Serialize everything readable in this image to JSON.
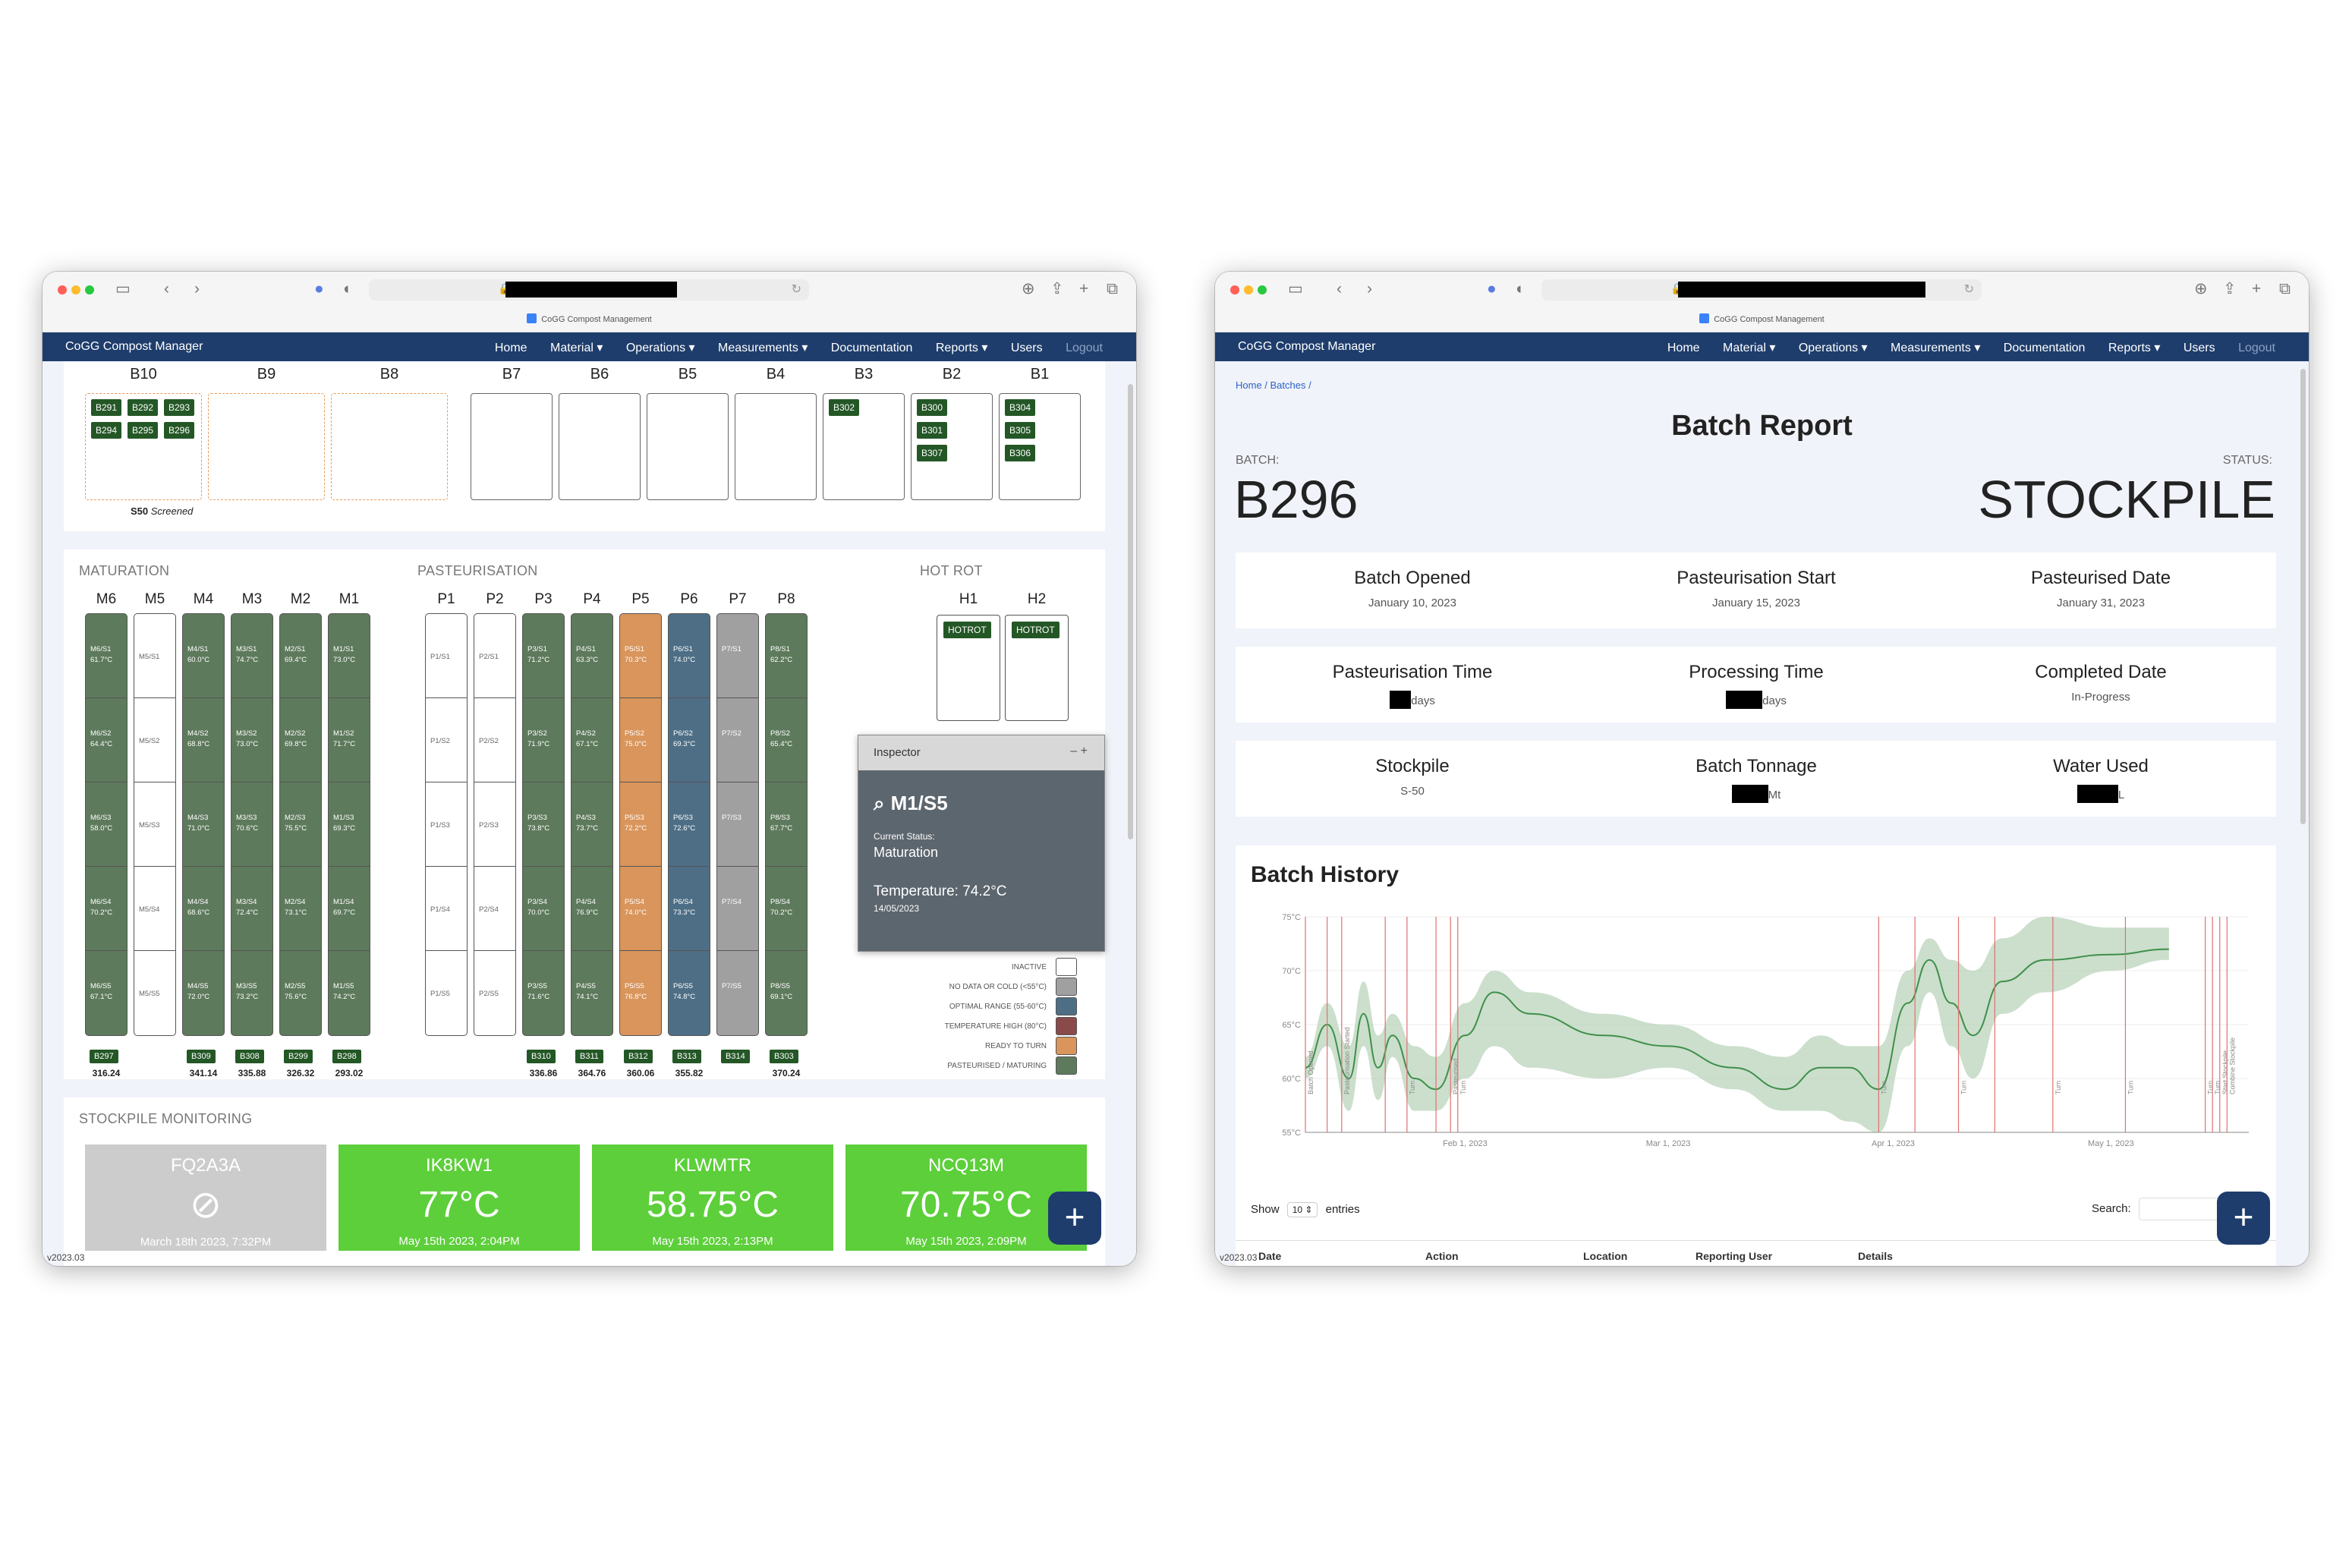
{
  "browser": {
    "tab_title": "CoGG Compost Management"
  },
  "nav": {
    "brand": "CoGG Compost Manager",
    "home": "Home",
    "material": "Material ▾",
    "operations": "Operations ▾",
    "measurements": "Measurements ▾",
    "documentation": "Documentation",
    "reports": "Reports ▾",
    "users": "Users",
    "logout": "Logout"
  },
  "bays": {
    "headers": [
      "B10",
      "B9",
      "B8",
      "B7",
      "B6",
      "B5",
      "B4",
      "B3",
      "B2",
      "B1"
    ],
    "b10_tags": [
      "B291",
      "B292",
      "B293",
      "B294",
      "B295",
      "B296"
    ],
    "b3_tags": [
      "B302"
    ],
    "b2_tags": [
      "B300",
      "B301",
      "B307"
    ],
    "b1_tags": [
      "B304",
      "B305",
      "B306"
    ],
    "b10_footer_code": "S50",
    "b10_footer_status": "Screened"
  },
  "sections": {
    "maturation": "MATURATION",
    "pasteurisation": "PASTEURISATION",
    "hot_rot": "HOT ROT",
    "stockpile": "STOCKPILE MONITORING"
  },
  "columns": [
    {
      "name": "M6",
      "color": "#5e7a5c",
      "cells": [
        "M6/S1 61.7°C",
        "M6/S2 64.4°C",
        "M6/S3 58.0°C",
        "M6/S4 70.2°C",
        "M6/S5 67.1°C"
      ],
      "batch": "B297",
      "value": "316.24"
    },
    {
      "name": "M5",
      "color": "#ffffff",
      "cells": [
        "M5/S1",
        "M5/S2",
        "M5/S3",
        "M5/S4",
        "M5/S5"
      ],
      "batch": "",
      "value": ""
    },
    {
      "name": "M4",
      "color": "#5e7a5c",
      "cells": [
        "M4/S1 60.0°C",
        "M4/S2 68.8°C",
        "M4/S3 71.0°C",
        "M4/S4 68.6°C",
        "M4/S5 72.0°C"
      ],
      "batch": "B309",
      "value": "341.14"
    },
    {
      "name": "M3",
      "color": "#5e7a5c",
      "cells": [
        "M3/S1 74.7°C",
        "M3/S2 73.0°C",
        "M3/S3 70.6°C",
        "M3/S4 72.4°C",
        "M3/S5 73.2°C"
      ],
      "batch": "B308",
      "value": "335.88"
    },
    {
      "name": "M2",
      "color": "#5e7a5c",
      "cells": [
        "M2/S1 69.4°C",
        "M2/S2 69.8°C",
        "M2/S3 75.5°C",
        "M2/S4 73.1°C",
        "M2/S5 75.6°C"
      ],
      "batch": "B299",
      "value": "326.32"
    },
    {
      "name": "M1",
      "color": "#5e7a5c",
      "cells": [
        "M1/S1 73.0°C",
        "M1/S2 71.7°C",
        "M1/S3 69.3°C",
        "M1/S4 69.7°C",
        "M1/S5 74.2°C"
      ],
      "batch": "B298",
      "value": "293.02"
    },
    {
      "name": "P1",
      "color": "#ffffff",
      "cells": [
        "P1/S1",
        "P1/S2",
        "P1/S3",
        "P1/S4",
        "P1/S5"
      ],
      "batch": "",
      "value": ""
    },
    {
      "name": "P2",
      "color": "#ffffff",
      "cells": [
        "P2/S1",
        "P2/S2",
        "P2/S3",
        "P2/S4",
        "P2/S5"
      ],
      "batch": "",
      "value": ""
    },
    {
      "name": "P3",
      "color": "#5e7a5c",
      "cells": [
        "P3/S1 71.2°C",
        "P3/S2 71.9°C",
        "P3/S3 73.8°C",
        "P3/S4 70.0°C",
        "P3/S5 71.6°C"
      ],
      "batch": "B310",
      "value": "336.86"
    },
    {
      "name": "P4",
      "color": "#5e7a5c",
      "cells": [
        "P4/S1 63.3°C",
        "P4/S2 67.1°C",
        "P4/S3 73.7°C",
        "P4/S4 76.9°C",
        "P4/S5 74.1°C"
      ],
      "batch": "B311",
      "value": "364.76"
    },
    {
      "name": "P5",
      "color": "#d9955b",
      "cells": [
        "P5/S1 70.3°C",
        "P5/S2 75.0°C",
        "P5/S3 72.2°C",
        "P5/S4 74.0°C",
        "P5/S5 76.8°C"
      ],
      "batch": "B312",
      "value": "360.06"
    },
    {
      "name": "P6",
      "color": "#4d6e85",
      "cells": [
        "P6/S1 74.0°C",
        "P6/S2 69.3°C",
        "P6/S3 72.6°C",
        "P6/S4 73.3°C",
        "P6/S5 74.8°C"
      ],
      "batch": "B313",
      "value": "355.82"
    },
    {
      "name": "P7",
      "color": "#a0a0a0",
      "cells": [
        "P7/S1",
        "P7/S2",
        "P7/S3",
        "P7/S4",
        "P7/S5"
      ],
      "batch": "B314",
      "value": ""
    },
    {
      "name": "P8",
      "color": "#5e7a5c",
      "cells": [
        "P8/S1 62.2°C",
        "P8/S2 65.4°C",
        "P8/S3 67.7°C",
        "P8/S4 70.2°C",
        "P8/S5 69.1°C"
      ],
      "batch": "B303",
      "value": "370.24"
    }
  ],
  "hotrot": {
    "h1": "H1",
    "h2": "H2",
    "tag": "HOTROT"
  },
  "legend": [
    {
      "label": "INACTIVE",
      "color": "#ffffff"
    },
    {
      "label": "NO DATA OR COLD (<55°C)",
      "color": "#a0a0a0"
    },
    {
      "label": "OPTIMAL RANGE (55-60°C)",
      "color": "#4d6e85"
    },
    {
      "label": "TEMPERATURE HIGH (80°C)",
      "color": "#8a4a4a"
    },
    {
      "label": "READY TO TURN",
      "color": "#d9955b"
    },
    {
      "label": "PASTEURISED / MATURING",
      "color": "#5e7a5c"
    }
  ],
  "inspector": {
    "title": "Inspector",
    "minimize": "–",
    "add": "+",
    "location": "M1/S5",
    "status_label": "Current Status:",
    "status": "Maturation",
    "temp": "Temperature: 74.2°C",
    "date": "14/05/2023"
  },
  "stockpile_cards": [
    {
      "name": "FQ2A3A",
      "temp": "",
      "date": "March 18th 2023, 7:32PM",
      "color": "#cccccc"
    },
    {
      "name": "IK8KW1",
      "temp": "77°C",
      "date": "May 15th 2023, 2:04PM",
      "color": "#5ccf3a"
    },
    {
      "name": "KLWMTR",
      "temp": "58.75°C",
      "date": "May 15th 2023, 2:13PM",
      "color": "#5ccf3a"
    },
    {
      "name": "NCQ13M",
      "temp": "70.75°C",
      "date": "May 15th 2023, 2:09PM",
      "color": "#5ccf3a"
    }
  ],
  "version": "v2023.03",
  "fab": "+",
  "report": {
    "breadcrumb": "Home / Batches /",
    "title": "Batch Report",
    "batch_label": "BATCH:",
    "batch": "B296",
    "status_label": "STATUS:",
    "status": "STOCKPILE",
    "row1": [
      {
        "h": "Batch Opened",
        "v": "January 10, 2023"
      },
      {
        "h": "Pasteurisation Start",
        "v": "January 15, 2023"
      },
      {
        "h": "Pasteurised Date",
        "v": "January 31, 2023"
      }
    ],
    "row2": [
      {
        "h": "Pasteurisation Time",
        "v": "days"
      },
      {
        "h": "Processing Time",
        "v": "days"
      },
      {
        "h": "Completed Date",
        "v": "In-Progress"
      }
    ],
    "row3": [
      {
        "h": "Stockpile",
        "v": "S-50"
      },
      {
        "h": "Batch Tonnage",
        "v": "Mt"
      },
      {
        "h": "Water Used",
        "v": "L"
      }
    ],
    "history_title": "Batch History",
    "show": "Show",
    "entries_sel": "10 ⇕",
    "entries": "entries",
    "search": "Search:",
    "table_headers": [
      "Date",
      "Action",
      "Location",
      "Reporting User",
      "Details"
    ]
  },
  "chart_data": {
    "type": "line",
    "title": "",
    "y_ticks": [
      "55°C",
      "60°C",
      "65°C",
      "70°C",
      "75°C"
    ],
    "ylim": [
      55,
      75
    ],
    "x_ticks": [
      "Feb 1, 2023",
      "Mar 1, 2023",
      "Apr 1, 2023",
      "May 1, 2023"
    ],
    "xlim": [
      "2023-01-10",
      "2023-05-20"
    ],
    "series": [
      {
        "x": [
          "2023-01-10",
          "2023-01-13",
          "2023-01-16",
          "2023-01-18",
          "2023-01-20",
          "2023-01-22",
          "2023-01-25",
          "2023-01-28",
          "2023-02-01",
          "2023-02-05",
          "2023-02-10",
          "2023-02-20",
          "2023-03-01",
          "2023-03-10",
          "2023-03-17",
          "2023-03-22",
          "2023-03-26",
          "2023-03-30",
          "2023-04-03",
          "2023-04-06",
          "2023-04-09",
          "2023-04-12",
          "2023-04-16",
          "2023-04-22",
          "2023-05-01",
          "2023-05-09"
        ],
        "y": [
          61,
          65,
          60,
          66,
          61,
          64,
          60,
          59,
          64,
          68,
          66,
          64,
          63,
          61,
          59,
          61,
          61,
          59,
          67,
          71,
          67,
          64,
          69,
          71,
          71.5,
          72
        ]
      }
    ],
    "band_upper": [
      62,
      67,
      63,
      69,
      64,
      66,
      63,
      62,
      67,
      70,
      68,
      66,
      65,
      63,
      62,
      64,
      63,
      63,
      70,
      73,
      71,
      70,
      73,
      75,
      74,
      74
    ],
    "band_lower": [
      60,
      63,
      57,
      63,
      58,
      62,
      57,
      57,
      60,
      63,
      61,
      60,
      61,
      59,
      57,
      57,
      56,
      55,
      63,
      68,
      63,
      60,
      66,
      68,
      70,
      71
    ],
    "annotations": [
      {
        "date": "2023-01-10",
        "label": "Batch Opened"
      },
      {
        "date": "2023-01-13",
        "label": ""
      },
      {
        "date": "2023-01-15",
        "label": "Pasteurisation Started"
      },
      {
        "date": "2023-01-21",
        "label": ""
      },
      {
        "date": "2023-01-24",
        "label": "Turn"
      },
      {
        "date": "2023-01-28",
        "label": ""
      },
      {
        "date": "2023-01-30",
        "label": "Pasteurised"
      },
      {
        "date": "2023-01-31",
        "label": "Turn"
      },
      {
        "date": "2023-03-30",
        "label": "Turn"
      },
      {
        "date": "2023-04-04",
        "label": ""
      },
      {
        "date": "2023-04-10",
        "label": "Turn"
      },
      {
        "date": "2023-04-15",
        "label": ""
      },
      {
        "date": "2023-04-23",
        "label": "Turn"
      },
      {
        "date": "2023-05-03",
        "label": "Turn"
      },
      {
        "date": "2023-05-14",
        "label": "Turn"
      },
      {
        "date": "2023-05-15",
        "label": "Turn"
      },
      {
        "date": "2023-05-16",
        "label": "Start Stockpile"
      },
      {
        "date": "2023-05-17",
        "label": "Combine Stockpile"
      }
    ]
  }
}
